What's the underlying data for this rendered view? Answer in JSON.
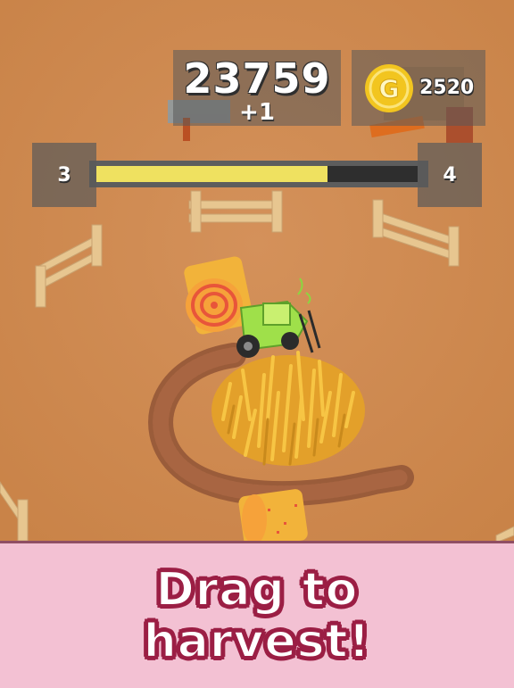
{
  "hud": {
    "score": "23759",
    "score_increment": "+1",
    "coins": "2520",
    "coin_symbol": "G",
    "level_current": "3",
    "level_next": "4",
    "level_progress": 0.72
  },
  "banner": {
    "line1": "Drag to",
    "line2": "harvest!"
  },
  "colors": {
    "ground": "#cf8a4e",
    "banner_bg": "#f3c1d3",
    "banner_text_outline": "#9b1e44",
    "progress_fill": "#efe160",
    "coin_gold": "#f2c51f",
    "tractor_body": "#9fe04a",
    "wheat": "#f0b22c"
  }
}
